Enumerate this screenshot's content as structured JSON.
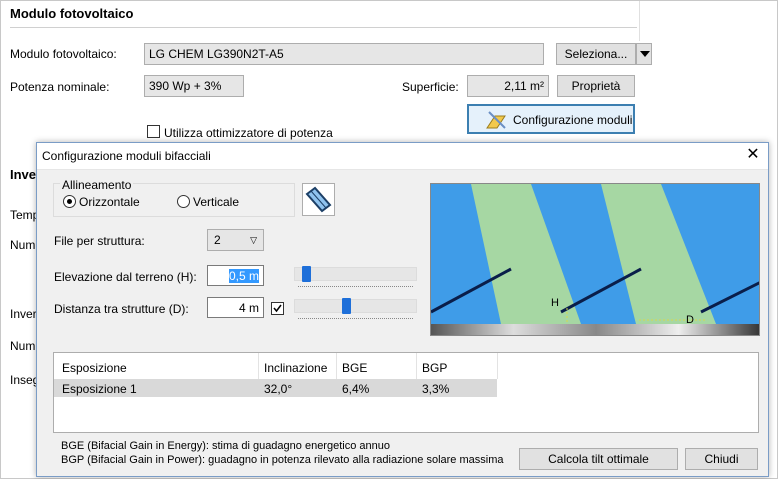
{
  "background": {
    "section_title": "Modulo fotovoltaico",
    "module_label": "Modulo fotovoltaico:",
    "module_value": "LG CHEM LG390N2T-A5",
    "select_button": "Seleziona...",
    "power_label": "Potenza nominale:",
    "power_value": "390 Wp + 3%",
    "surface_label": "Superficie:",
    "surface_value": "2,11 m²",
    "properties_button": "Proprietà",
    "config_button": "Configurazione moduli",
    "optimizer_label": "Utilizza ottimizzatore di potenza",
    "cut_labels": [
      "Inve",
      "Temp",
      "Num",
      "Inver",
      "Num",
      "Inseg"
    ]
  },
  "dialog": {
    "title": "Configurazione moduli bifacciali",
    "alignment_legend": "Allineamento",
    "radio_horizontal": "Orizzontale",
    "radio_vertical": "Verticale",
    "alignment_selected": "horizontal",
    "rows_label": "File per struttura:",
    "rows_value": "2",
    "elevation_label": "Elevazione dal terreno (H):",
    "elevation_value": "0,5 m",
    "elevation_slider": 0.05,
    "distance_label": "Distanza tra strutture (D):",
    "distance_value": "4 m",
    "distance_checked": true,
    "distance_slider": 0.4,
    "diagram_labels": {
      "h": "H",
      "d": "D"
    },
    "table": {
      "headers": [
        "Esposizione",
        "Inclinazione",
        "BGE",
        "BGP"
      ],
      "rows": [
        [
          "Esposizione 1",
          "32,0°",
          "6,4%",
          "3,3%"
        ]
      ]
    },
    "footnote_bge": "BGE (Bifacial Gain in Energy): stima di guadagno energetico annuo",
    "footnote_bgp": "BGP (Bifacial Gain in Power): guadagno in potenza rilevato alla radiazione solare massima",
    "calc_button": "Calcola tilt ottimale",
    "close_button": "Chiudi"
  },
  "colors": {
    "sky": "#3f9ce8",
    "panel": "#a6d7a3",
    "slider_thumb": "#1e6fd9",
    "selection": "#3399ff"
  }
}
